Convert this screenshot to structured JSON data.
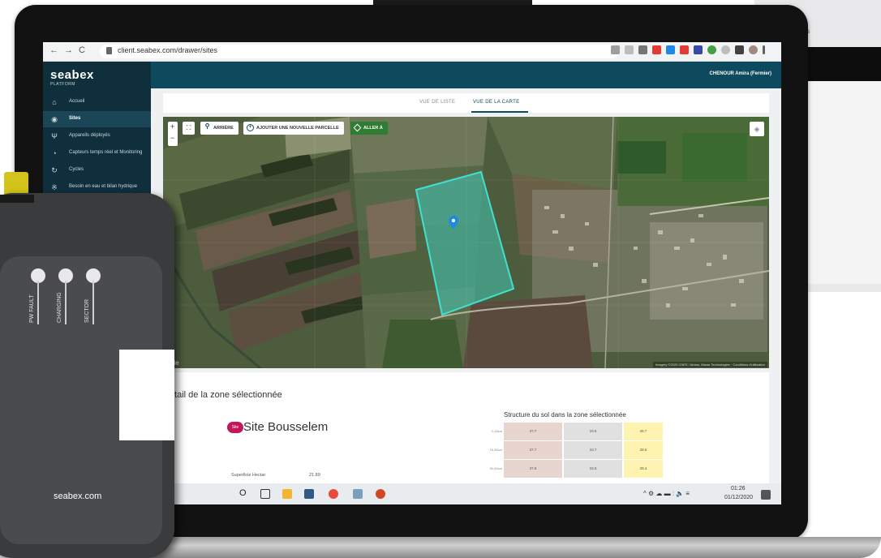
{
  "background_device": {
    "text_left": "s",
    "text_right": "("
  },
  "browser": {
    "url": "client.seabex.com/drawer/sites"
  },
  "app": {
    "logo": "seabex",
    "logo_sub": "PLATFORM",
    "user": "CHENOUR Amira (Fermier)"
  },
  "sidebar": {
    "items": [
      {
        "label": "Accueil",
        "icon": "home-icon"
      },
      {
        "label": "Sites",
        "icon": "location-icon"
      },
      {
        "label": "Appareils déployés",
        "icon": "antenna-icon"
      },
      {
        "label": "Capteurs temps réel et Monitoring",
        "icon": "gauge-icon"
      },
      {
        "label": "Cycles",
        "icon": "cycle-icon"
      },
      {
        "label": "Besoin en eau et bilan hydrique",
        "icon": "water-icon"
      }
    ]
  },
  "tabs": {
    "list": "VUE DE LISTE",
    "map": "VUE DE LA CARTE"
  },
  "map": {
    "zoom_in": "+",
    "zoom_out": "−",
    "back": "ARRIÈRE",
    "add_parcel": "AJOUTER UNE NOUVELLE PARCELLE",
    "goto": "ALLER À",
    "google": "oogle",
    "attribution": "Imagery ©2020 CNES / Airbus, Maxar Technologies · Conditions d'utilisation"
  },
  "detail": {
    "title": "Détail de la zone sélectionnée",
    "badge": "Site",
    "site_name": "Site Bousselem",
    "area_label": "Superficie Hectar",
    "area_value": "21.89",
    "soil_title": "Structure du sol dans la zone sélectionnée",
    "soil_rows": [
      {
        "label": "0-15cm",
        "values": [
          "37.7",
          "33.6",
          "28.7"
        ]
      },
      {
        "label": "15-30cm",
        "values": [
          "37.7",
          "33.7",
          "28.6"
        ]
      },
      {
        "label": "30-60cm",
        "values": [
          "37.8",
          "33.8",
          "28.4"
        ]
      }
    ]
  },
  "taskbar": {
    "search": "O",
    "tray": "^",
    "time": "01:26",
    "date": "01/12/2020"
  },
  "device": {
    "led_labels": [
      "PW FAULT",
      "CHARGING",
      "SECTOR"
    ],
    "brand": "seabex.com"
  },
  "colors": {
    "header": "#0d4a5e",
    "sidebar": "#0f2f3d",
    "parcel": "#40e0d0",
    "badge": "#c2185b",
    "clay": "#e8d5cf",
    "silt": "#e0e0e0",
    "sand": "#fff3b0"
  }
}
